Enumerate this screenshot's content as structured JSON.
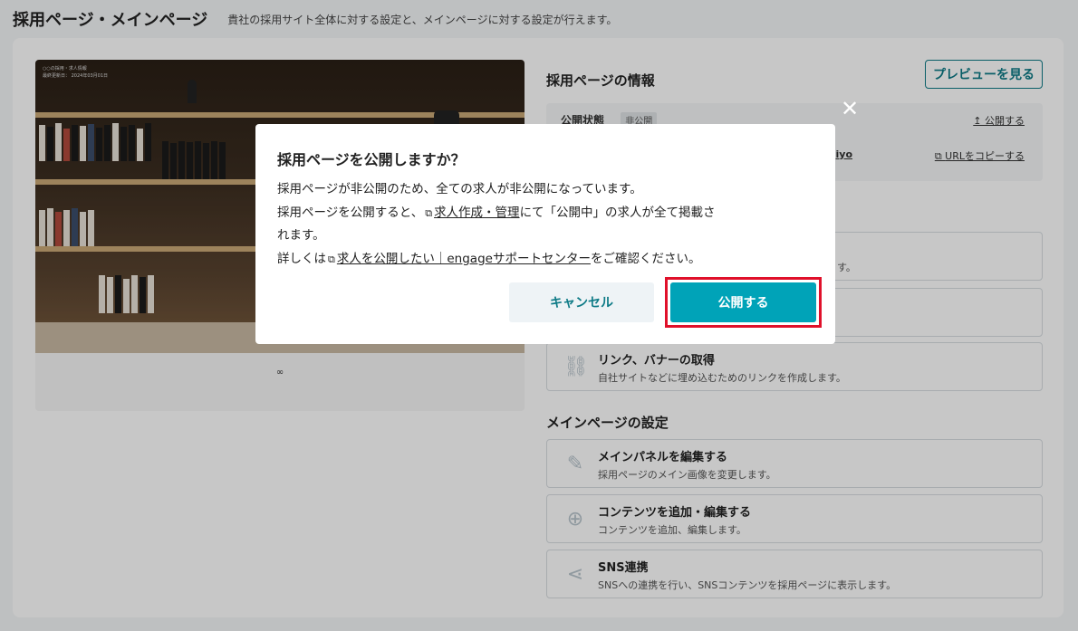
{
  "header": {
    "title": "採用ページ・メインページ",
    "description": "貴社の採用サイト全体に対する設定と、メインページに対する設定が行えます。"
  },
  "preview": {
    "breadcrumb_line1": "○○の採用・求人情報",
    "breadcrumb_line2": "最終更新日： 2024年03月01日",
    "logo_text": "∞"
  },
  "info": {
    "section_title": "採用ページの情報",
    "preview_button": "プレビューを見る",
    "status_label": "公開状態",
    "status_badge": "非公開",
    "publish_link": "公開する",
    "url_fragment": "iyo",
    "copy_url_link": "URLをコピーする"
  },
  "cards": {
    "link_banner": {
      "title": "リンク、バナーの取得",
      "sub": "自社サイトなどに埋め込むためのリンクを作成します。"
    },
    "partial_sub": "す。"
  },
  "main_settings": {
    "section_title": "メインページの設定",
    "items": [
      {
        "title": "メインパネルを編集する",
        "sub": "採用ページのメイン画像を変更します。",
        "icon": "pencil-icon"
      },
      {
        "title": "コンテンツを追加・編集する",
        "sub": "コンテンツを追加、編集します。",
        "icon": "plus-circle-icon"
      },
      {
        "title": "SNS連携",
        "sub": "SNSへの連携を行い、SNSコンテンツを採用ページに表示します。",
        "icon": "share-icon"
      }
    ]
  },
  "modal": {
    "title": "採用ページを公開しますか？",
    "line1": "採用ページが非公開のため、全ての求人が非公開になっています。",
    "line2_pre": "採用ページを公開すると、",
    "line2_link": "求人作成・管理",
    "line2_post": "にて「公開中」の求人が全て掲載さ",
    "line3": "れます。",
    "line4_pre": "詳しくは",
    "line4_link": "求人を公開したい｜engageサポートセンター",
    "line4_post": "をご確認ください。",
    "cancel_label": "キャンセル",
    "publish_label": "公開する"
  },
  "colors": {
    "accent": "#00a3b8",
    "accent_dark": "#0d7a86",
    "highlight": "#e0102a"
  }
}
